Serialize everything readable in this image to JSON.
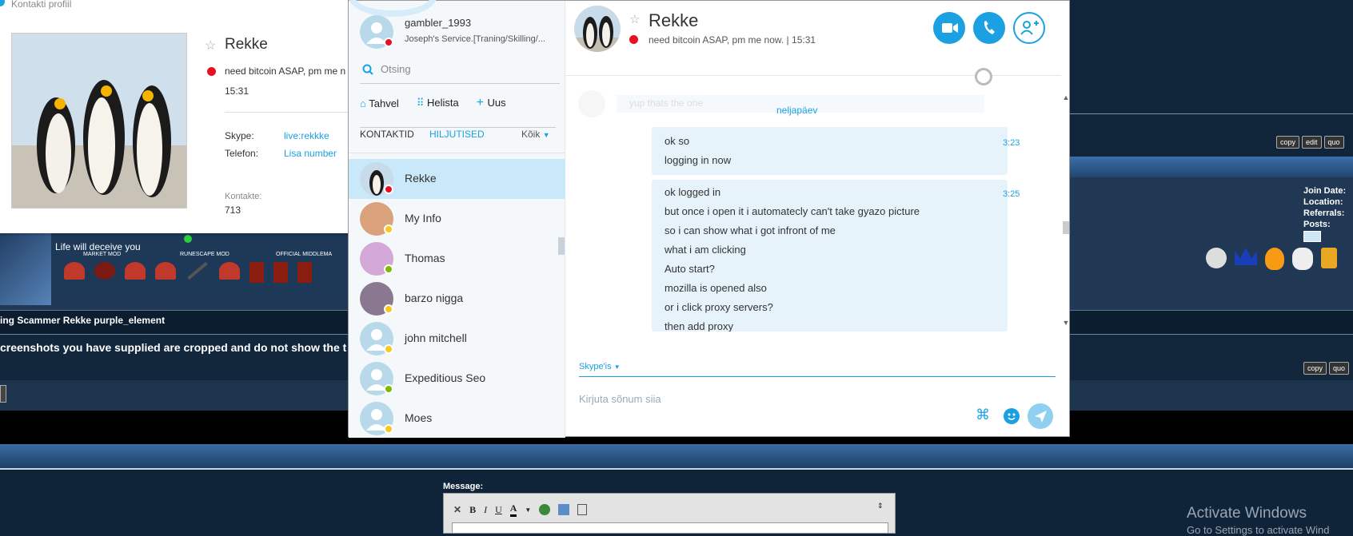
{
  "profile_card": {
    "title": "Kontakti profiil",
    "name": "Rekke",
    "mood": "need bitcoin ASAP, pm me n",
    "time": "15:31",
    "skype_label": "Skype:",
    "skype_value": "live:rekkke",
    "phone_label": "Telefon:",
    "phone_value": "Lisa number",
    "contacts_label": "Kontakte:",
    "contacts_value": "713"
  },
  "skype": {
    "me": {
      "username": "gambler_1993",
      "mood": "Joseph's Service.[Traning/Skilling/..."
    },
    "search_placeholder": "Otsing",
    "nav": [
      "Tahvel",
      "Helista",
      "Uus"
    ],
    "tabs": {
      "contacts": "KONTAKTID",
      "recent": "HILJUTISED",
      "filter": "Kõik"
    },
    "contacts": [
      {
        "name": "Rekke",
        "status": "busy"
      },
      {
        "name": "My Info",
        "status": "away"
      },
      {
        "name": "Thomas",
        "status": "online"
      },
      {
        "name": "barzo nigga",
        "status": "away"
      },
      {
        "name": "john mitchell",
        "status": "away"
      },
      {
        "name": "Expeditious Seo",
        "status": "online"
      },
      {
        "name": "Moes",
        "status": "away"
      }
    ],
    "chat": {
      "name": "Rekke",
      "mood": "need bitcoin ASAP, pm me now.",
      "time": "15:31",
      "faded_msg": "yup thats the one",
      "day_label": "neljapäev",
      "groups": [
        {
          "time": "3:23",
          "messages": [
            "ok so",
            "logging in now"
          ]
        },
        {
          "time": "3:25",
          "messages": [
            "ok logged in",
            "but once i open it i automatecly can't take gyazo picture",
            "so i can show what i got infront of me",
            "what i am clicking",
            "Auto start?",
            "mozilla is opened also",
            "or i click proxy servers?",
            "then add proxy"
          ]
        }
      ],
      "via": "Skype'is",
      "compose_placeholder": "Kirjuta sõnum siia"
    }
  },
  "forum": {
    "signature_text": "Life will deceive you",
    "rank_labels": [
      "MARKET MOD",
      "RUNESCAPE MOD",
      "OFFICIAL MIDDLEMA"
    ],
    "thread_title": "ing Scammer Rekke purple_element",
    "post_text": "creenshots you have supplied are cropped and do not show the t",
    "side_info": [
      "Join Date:",
      "Location:",
      "Referrals:",
      "Posts:"
    ],
    "buttons_top": [
      "copy",
      "edit",
      "quo"
    ],
    "buttons_bottom": [
      "copy",
      "quo"
    ],
    "message_label": "Message:",
    "editor_buttons": [
      "B",
      "I",
      "U",
      "A"
    ],
    "activate_title": "Activate Windows",
    "activate_sub": "Go to Settings to activate Wind"
  }
}
